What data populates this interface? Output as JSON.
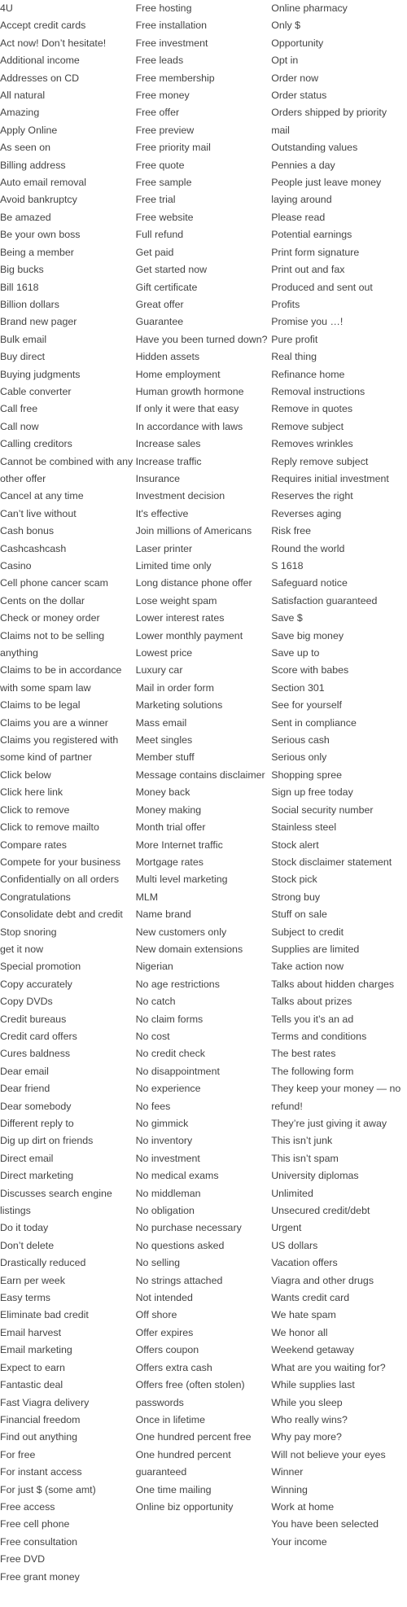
{
  "columns": [
    [
      "4U",
      "Accept credit cards",
      "Act now! Don’t hesitate!",
      "Additional income",
      "Addresses on CD",
      "All natural",
      "Amazing",
      "Apply Online",
      "As seen on",
      "Billing address",
      "Auto email removal",
      "Avoid bankruptcy",
      "Be amazed",
      "Be your own boss",
      "Being a member",
      "Big bucks",
      "Bill 1618",
      "Billion dollars",
      "Brand new pager",
      "Bulk email",
      "Buy direct",
      "Buying judgments",
      "Cable converter",
      "Call free",
      "Call now",
      "Calling creditors",
      "Cannot be combined with any other offer",
      "Cancel at any time",
      "Can’t live without",
      "Cash bonus",
      "Cashcashcash",
      "Casino",
      "Cell phone cancer scam",
      "Cents on the dollar",
      "Check or money order",
      "Claims not to be selling anything",
      "Claims to be in accordance with some spam law",
      "Claims to be legal",
      "Claims you are a winner",
      "Claims you registered with some kind of partner",
      "Click below",
      "Click here link",
      "Click to remove",
      "Click to remove mailto",
      "Compare rates",
      "Compete for your business",
      "Confidentially on all orders",
      "Congratulations",
      "Consolidate debt and credit",
      "Stop snoring",
      "get it now",
      "Special promotion",
      "Copy accurately",
      "Copy DVDs",
      "Credit bureaus",
      "Credit card offers",
      "Cures baldness",
      "Dear email",
      "Dear friend",
      "Dear somebody",
      "Different reply to",
      "Dig up dirt on friends",
      "Direct email",
      "Direct marketing",
      "Discusses search engine listings",
      "Do it today",
      "Don’t delete",
      "Drastically reduced",
      "Earn per week",
      "Easy terms",
      "Eliminate bad credit",
      "Email harvest",
      "Email marketing",
      "Expect to earn",
      "Fantastic deal",
      "Fast Viagra delivery",
      "Financial freedom",
      "Find out anything",
      "For free",
      "For instant access",
      "For just $ (some amt)",
      "Free access",
      "Free cell phone",
      "Free consultation",
      "Free DVD",
      "Free grant money"
    ],
    [
      "Free hosting",
      "Free installation",
      "Free investment",
      "Free leads",
      "Free membership",
      "Free money",
      "Free offer",
      "Free preview",
      "Free priority mail",
      "Free quote",
      "Free sample",
      "Free trial",
      "Free website",
      "Full refund",
      "Get paid",
      "Get started now",
      "Gift certificate",
      "Great offer",
      "Guarantee",
      "Have you been turned down?",
      "Hidden assets",
      "Home employment",
      "Human growth hormone",
      "If only it were that easy",
      "In accordance with laws",
      "Increase sales",
      "Increase traffic",
      "Insurance",
      "Investment decision",
      "It's effective",
      "Join millions of Americans",
      "Laser printer",
      "Limited time only",
      "Long distance phone offer",
      "Lose weight spam",
      "Lower interest rates",
      "Lower monthly payment",
      "Lowest price",
      "Luxury car",
      "Mail in order form",
      "Marketing solutions",
      "Mass email",
      "Meet singles",
      "Member stuff",
      "Message contains disclaimer",
      "Money back",
      "Money making",
      "Month trial offer",
      "More Internet traffic",
      "Mortgage rates",
      "Multi level marketing",
      "MLM",
      "Name brand",
      "New customers only",
      "New domain extensions",
      "Nigerian",
      "No age restrictions",
      "No catch",
      "No claim forms",
      "No cost",
      "No credit check",
      "No disappointment",
      "No experience",
      "No fees",
      "No gimmick",
      "No inventory",
      "No investment",
      "No medical exams",
      "No middleman",
      "No obligation",
      "No purchase necessary",
      "No questions asked",
      "No selling",
      "No strings attached",
      "Not intended",
      "Off shore",
      "Offer expires",
      "Offers coupon",
      "Offers extra cash",
      "Offers free (often stolen) passwords",
      "Once in lifetime",
      "One hundred percent free",
      "One hundred percent guaranteed",
      "One time mailing",
      "Online biz opportunity"
    ],
    [
      "Online pharmacy",
      "Only $",
      "Opportunity",
      "Opt in",
      "Order now",
      "Order status",
      "Orders shipped by priority mail",
      "Outstanding values",
      "Pennies a day",
      "People just leave money laying around",
      "Please read",
      "Potential earnings",
      "Print form signature",
      "Print out and fax",
      "Produced and sent out",
      "Profits",
      "Promise you …!",
      "Pure profit",
      "Real thing",
      "Refinance home",
      "Removal instructions",
      "Remove in quotes",
      "Remove subject",
      "Removes wrinkles",
      "Reply remove subject",
      "Requires initial investment",
      "Reserves the right",
      "Reverses aging",
      "Risk free",
      "Round the world",
      "S 1618",
      "Safeguard notice",
      "Satisfaction guaranteed",
      "Save $",
      "Save big money",
      "Save up to",
      "Score with babes",
      "Section 301",
      "See for yourself",
      "Sent in compliance",
      "Serious cash",
      "Serious only",
      "Shopping spree",
      "Sign up free today",
      "Social security number",
      "Stainless steel",
      "Stock alert",
      "Stock disclaimer statement",
      "Stock pick",
      "Strong buy",
      "Stuff on sale",
      "Subject to credit",
      "Supplies are limited",
      "Take action now",
      "Talks about hidden charges",
      "Talks about prizes",
      "Tells you it’s an ad",
      "Terms and conditions",
      "The best rates",
      "The following form",
      "They keep your money — no refund!",
      "They’re just giving it away",
      "This isn’t junk",
      "This isn’t spam",
      "University diplomas",
      "Unlimited",
      "Unsecured credit/debt",
      "Urgent",
      "US dollars",
      "Vacation offers",
      "Viagra and other drugs",
      "Wants credit card",
      "We hate spam",
      "We honor all",
      "Weekend getaway",
      "What are you waiting for?",
      "While supplies last",
      "While you sleep",
      "Who really wins?",
      "Why pay more?",
      "Will not believe your eyes",
      "Winner",
      "Winning",
      "Work at home",
      "You have been selected",
      "Your income"
    ]
  ]
}
